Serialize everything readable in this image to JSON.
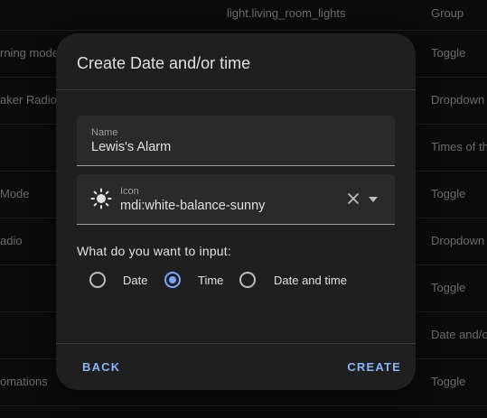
{
  "background_table": {
    "rows": [
      {
        "name": "",
        "entity": "light.living_room_lights",
        "type": "Group"
      },
      {
        "name": "rning mode",
        "entity": "",
        "type": "Toggle"
      },
      {
        "name": "aker Radio",
        "entity": "",
        "type": "Dropdown"
      },
      {
        "name": "",
        "entity": "",
        "type": "Times of th"
      },
      {
        "name": "Mode",
        "entity": "",
        "type": "Toggle"
      },
      {
        "name": "adio",
        "entity": "",
        "type": "Dropdown"
      },
      {
        "name": "",
        "entity": "",
        "type": "Toggle"
      },
      {
        "name": "",
        "entity": "",
        "type": "Date and/o"
      },
      {
        "name": "omations",
        "entity": "",
        "type": "Toggle"
      }
    ]
  },
  "dialog": {
    "title": "Create Date and/or time",
    "name_field": {
      "label": "Name",
      "value": "Lewis's Alarm"
    },
    "icon_field": {
      "label": "Icon",
      "value": "mdi:white-balance-sunny",
      "icon": "white-balance-sunny-icon"
    },
    "question": "What do you want to input:",
    "options": [
      {
        "label": "Date",
        "checked": false
      },
      {
        "label": "Time",
        "checked": true
      },
      {
        "label": "Date and time",
        "checked": false
      }
    ],
    "back_label": "BACK",
    "create_label": "CREATE"
  },
  "colors": {
    "accent": "#8ab4f8",
    "dialog_bg": "#1f1f1f",
    "page_bg": "#111111"
  }
}
